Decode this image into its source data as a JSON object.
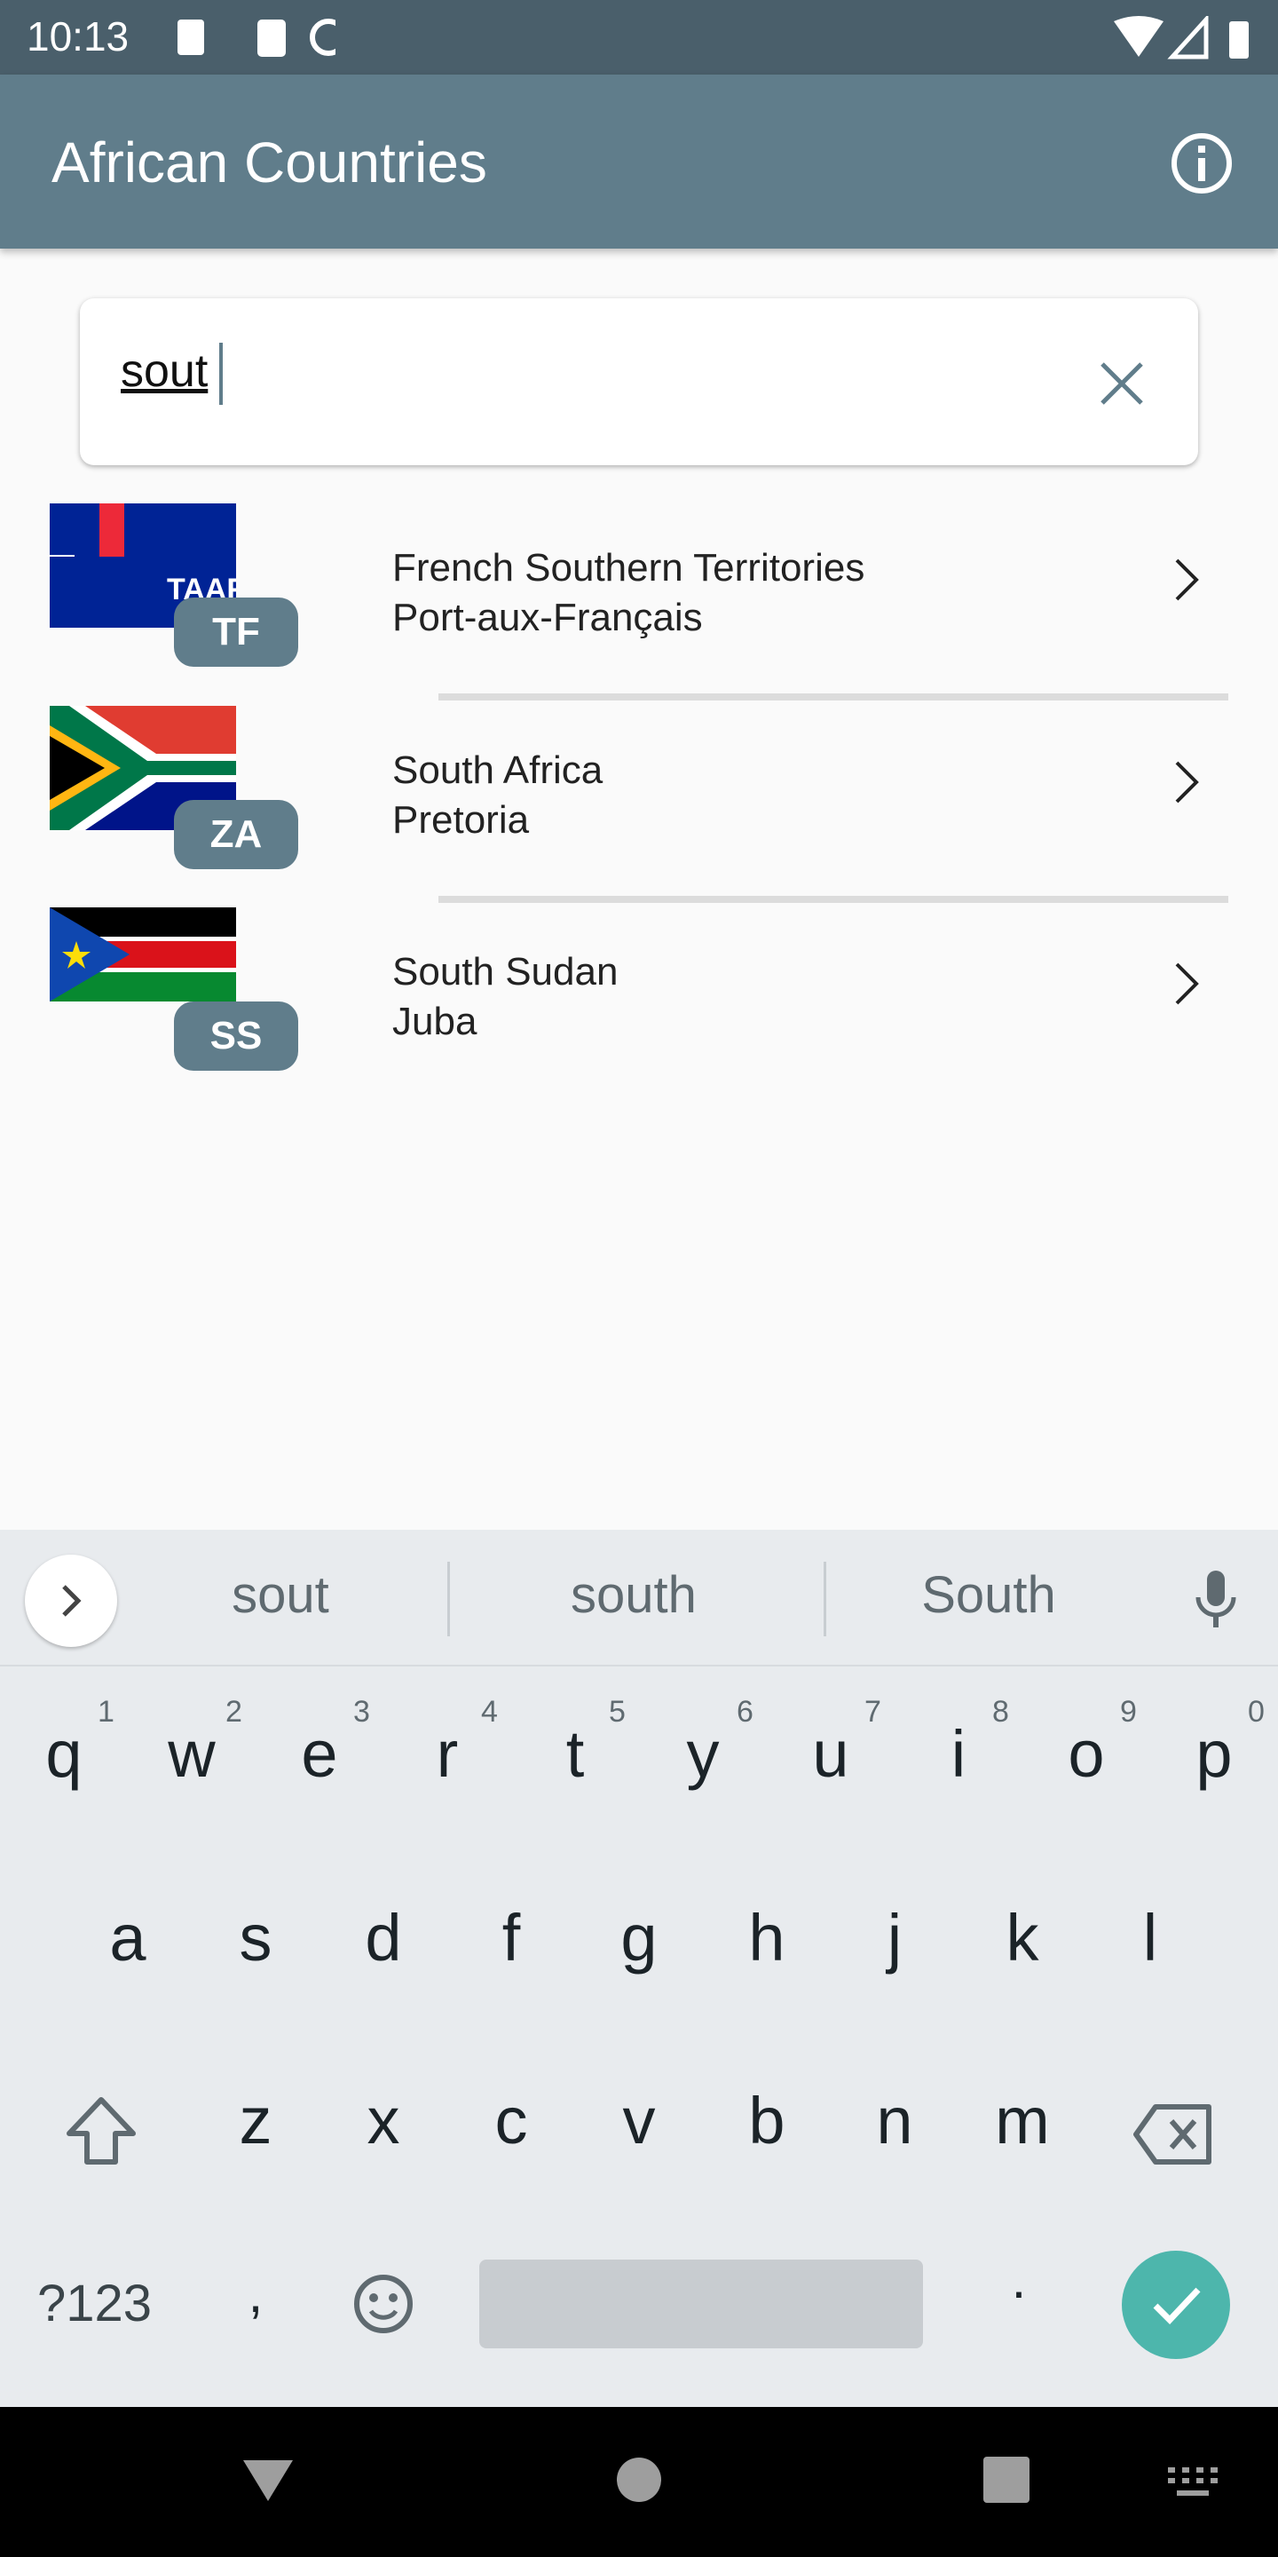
{
  "status_bar": {
    "time": "10:13"
  },
  "app_bar": {
    "title": "African Countries",
    "info_icon": "info-icon"
  },
  "search": {
    "value": "sout",
    "clear_icon": "close-icon"
  },
  "countries": [
    {
      "code": "TF",
      "name": "French Southern Territories",
      "capital": "Port-aux-Français"
    },
    {
      "code": "ZA",
      "name": "South Africa",
      "capital": "Pretoria"
    },
    {
      "code": "SS",
      "name": "South Sudan",
      "capital": "Juba"
    }
  ],
  "keyboard": {
    "suggestions": [
      "sout",
      "south",
      "South"
    ],
    "row1": [
      "q",
      "w",
      "e",
      "r",
      "t",
      "y",
      "u",
      "i",
      "o",
      "p"
    ],
    "row1_nums": [
      "1",
      "2",
      "3",
      "4",
      "5",
      "6",
      "7",
      "8",
      "9",
      "0"
    ],
    "row2": [
      "a",
      "s",
      "d",
      "f",
      "g",
      "h",
      "j",
      "k",
      "l"
    ],
    "row3": [
      "z",
      "x",
      "c",
      "v",
      "b",
      "n",
      "m"
    ],
    "symbols_label": "?123",
    "comma": ",",
    "period": "."
  },
  "colors": {
    "primary": "#607d8b",
    "status": "#4a5f6b",
    "accent": "#4db6ac"
  }
}
